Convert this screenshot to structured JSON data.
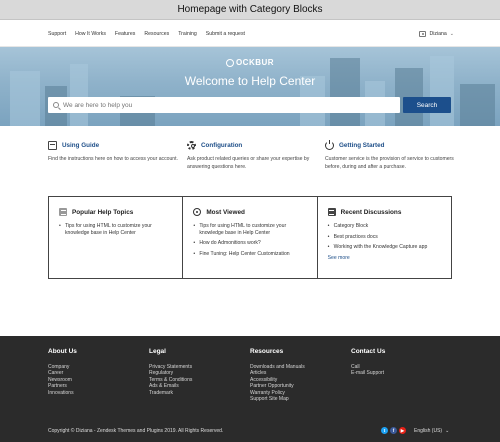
{
  "window": {
    "title": "Homepage with Category Blocks"
  },
  "nav": {
    "links": [
      "Support",
      "How It Works",
      "Features",
      "Resources",
      "Training",
      "Submit a request"
    ],
    "user_name": "Diziana"
  },
  "hero": {
    "logo_text": "OCKBUR",
    "welcome": "Welcome to Help Center",
    "search_placeholder": "We are here to help you",
    "search_button": "Search"
  },
  "categories": [
    {
      "icon": "book-icon",
      "title": "Using Guide",
      "description": "Find the instructions here on how to access your account."
    },
    {
      "icon": "gear-icon",
      "title": "Configuration",
      "description": "Ask product related queries or share your expertise by answering questions here."
    },
    {
      "icon": "power-icon",
      "title": "Getting Started",
      "description": "Customer service is the provision of service to customers before, during and after a purchase."
    }
  ],
  "blocks": {
    "popular": {
      "title": "Popular Help Topics",
      "items": [
        "Tips for using HTML to customize your knowledge base in Help Center"
      ]
    },
    "most_viewed": {
      "title": "Most Viewed",
      "items": [
        "Tips for using HTML to customize your knowledge base in Help Center",
        "How do Admonitions work?",
        "Fine Tuning: Help Center Customization"
      ]
    },
    "discussions": {
      "title": "Recent Discussions",
      "items": [
        "Category Block",
        "Best practices docs",
        "Working with the Knowledge Capture app"
      ],
      "see_more": "See more"
    }
  },
  "footer": {
    "about": {
      "title": "About Us",
      "links": [
        "Company",
        "Career",
        "Newsroom",
        "Partners",
        "Innovations"
      ]
    },
    "legal": {
      "title": "Legal",
      "links": [
        "Privacy Statements",
        "Regulatory",
        "Terms & Conditions",
        "Ads & Emails",
        "Trademark"
      ]
    },
    "resources": {
      "title": "Resources",
      "links": [
        "Downloads and Manuals",
        "Articles",
        "Accessibility",
        "Partner Opportunity",
        "Warranty Policy",
        "Support Site Map"
      ]
    },
    "contact": {
      "title": "Contact Us",
      "links": [
        "Call",
        "E-mail Support"
      ]
    },
    "copyright": "Copyright © Diziana - Zendesk Themes and Plugins 2019. All Rights Reserved.",
    "social": [
      {
        "icon": "twitter-icon",
        "glyph": "t",
        "color": "#1da1f2"
      },
      {
        "icon": "facebook-icon",
        "glyph": "f",
        "color": "#3b5998"
      },
      {
        "icon": "youtube-icon",
        "glyph": "▶",
        "color": "#e62117"
      }
    ],
    "language": "English (US)"
  },
  "colors": {
    "accent": "#1d4e88",
    "search_button": "#1c4f8c",
    "footer_bg": "#2b2b2b"
  }
}
